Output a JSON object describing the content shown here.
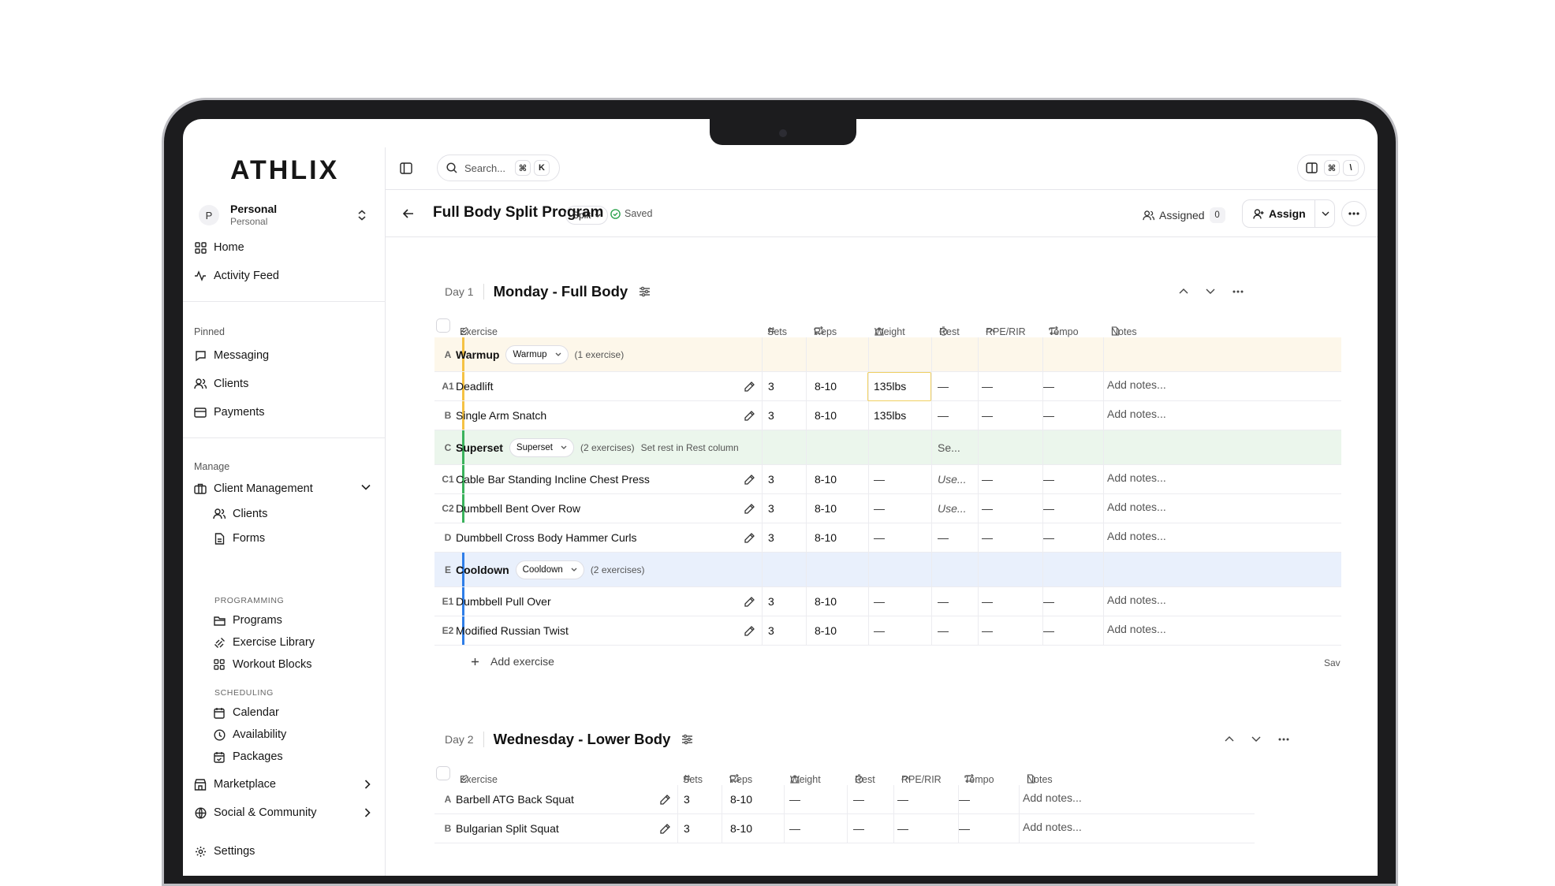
{
  "app": {
    "logo": "ATHLIX"
  },
  "workspace": {
    "avatar": "P",
    "name": "Personal",
    "type": "Personal"
  },
  "sidebar": {
    "top_items": [
      {
        "label": "Home"
      },
      {
        "label": "Activity Feed"
      }
    ],
    "pinned_label": "Pinned",
    "pinned_items": [
      {
        "label": "Messaging"
      },
      {
        "label": "Clients"
      },
      {
        "label": "Payments"
      }
    ],
    "manage_label": "Manage",
    "client_management": {
      "label": "Client Management",
      "items": [
        {
          "label": "Clients"
        },
        {
          "label": "Forms"
        }
      ]
    },
    "programming_label": "PROGRAMMING",
    "programming_items": [
      {
        "label": "Programs"
      },
      {
        "label": "Exercise Library"
      },
      {
        "label": "Workout Blocks"
      }
    ],
    "scheduling_label": "SCHEDULING",
    "scheduling_items": [
      {
        "label": "Calendar"
      },
      {
        "label": "Availability"
      },
      {
        "label": "Packages"
      }
    ],
    "marketplace": "Marketplace",
    "social": "Social & Community",
    "settings": "Settings"
  },
  "topbar": {
    "search_placeholder": "Search...",
    "kbd1": "⌘",
    "kbd2": "K",
    "kbd3": "⌘",
    "kbd4": "\\"
  },
  "header": {
    "title": "Full Body Split Program",
    "type_pill": "Split",
    "saved": "Saved",
    "assigned_label": "Assigned",
    "assigned_count": "0",
    "assign_label": "Assign"
  },
  "columns": {
    "exercise": "Exercise",
    "sets": "Sets",
    "reps": "Reps",
    "weight": "Weight",
    "rest": "Rest",
    "rpe": "RPE/RIR",
    "tempo": "Tempo",
    "notes": "Notes"
  },
  "day1": {
    "num": "Day 1",
    "title": "Monday - Full Body",
    "groups": {
      "warmup": {
        "code": "A",
        "name": "Warmup",
        "chip": "Warmup",
        "meta": "(1 exercise)"
      },
      "superset": {
        "code": "C",
        "name": "Superset",
        "chip": "Superset",
        "meta": "(2 exercises)",
        "meta2": "Set rest in Rest column",
        "rest": "Se..."
      },
      "cooldown": {
        "code": "E",
        "name": "Cooldown",
        "chip": "Cooldown",
        "meta": "(2 exercises)"
      }
    },
    "rows": [
      {
        "code": "A1",
        "name": "Deadlift",
        "sets": "3",
        "reps": "8-10",
        "weight": "135lbs",
        "rest": "—",
        "rpe": "—",
        "tempo": "—",
        "notes": "Add notes..."
      },
      {
        "code": "B",
        "name": "Single Arm Snatch",
        "sets": "3",
        "reps": "8-10",
        "weight": "135lbs",
        "rest": "—",
        "rpe": "—",
        "tempo": "—",
        "notes": "Add notes..."
      },
      {
        "code": "C1",
        "name": "Cable Bar Standing Incline Chest Press",
        "sets": "3",
        "reps": "8-10",
        "weight": "—",
        "rest": "Use...",
        "rpe": "—",
        "tempo": "—",
        "notes": "Add notes..."
      },
      {
        "code": "C2",
        "name": "Dumbbell Bent Over Row",
        "sets": "3",
        "reps": "8-10",
        "weight": "—",
        "rest": "Use...",
        "rpe": "—",
        "tempo": "—",
        "notes": "Add notes..."
      },
      {
        "code": "D",
        "name": "Dumbbell Cross Body Hammer Curls",
        "sets": "3",
        "reps": "8-10",
        "weight": "—",
        "rest": "—",
        "rpe": "—",
        "tempo": "—",
        "notes": "Add notes..."
      },
      {
        "code": "E1",
        "name": "Dumbbell Pull Over",
        "sets": "3",
        "reps": "8-10",
        "weight": "—",
        "rest": "—",
        "rpe": "—",
        "tempo": "—",
        "notes": "Add notes..."
      },
      {
        "code": "E2",
        "name": "Modified Russian Twist",
        "sets": "3",
        "reps": "8-10",
        "weight": "—",
        "rest": "—",
        "rpe": "—",
        "tempo": "—",
        "notes": "Add notes..."
      }
    ],
    "add_exercise": "Add exercise",
    "save_trunc": "Sav"
  },
  "day2": {
    "num": "Day 2",
    "title": "Wednesday - Lower Body",
    "rows": [
      {
        "code": "A",
        "name": "Barbell ATG Back Squat",
        "sets": "3",
        "reps": "8-10",
        "weight": "—",
        "rest": "—",
        "rpe": "—",
        "tempo": "—",
        "notes": "Add notes..."
      },
      {
        "code": "B",
        "name": "Bulgarian Split Squat",
        "sets": "3",
        "reps": "8-10",
        "weight": "—",
        "rest": "—",
        "rpe": "—",
        "tempo": "—",
        "notes": "Add notes..."
      }
    ]
  },
  "colors": {
    "warmup": "#f5c244",
    "warmup_bg": "#fdf7ea",
    "superset": "#3bb25c",
    "superset_bg": "#ebf6ec",
    "cooldown": "#2f7ee8",
    "cooldown_bg": "#e9f0fc",
    "saved_green": "#2da44e"
  }
}
